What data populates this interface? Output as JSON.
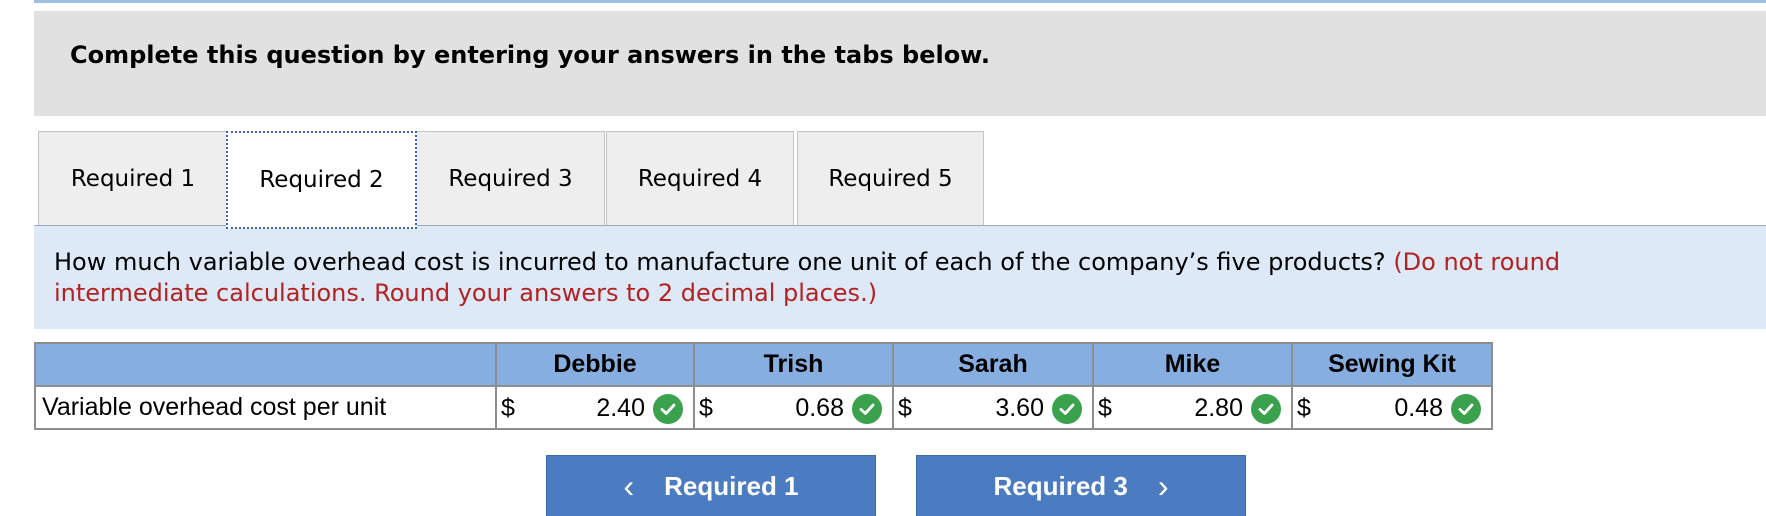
{
  "header": {
    "instruction": "Complete this question by entering your answers in the tabs below."
  },
  "tabs": [
    {
      "label": "Required 1",
      "active": false
    },
    {
      "label": "Required 2",
      "active": true
    },
    {
      "label": "Required 3",
      "active": false
    },
    {
      "label": "Required 4",
      "active": false
    },
    {
      "label": "Required 5",
      "active": false
    }
  ],
  "question": {
    "text": "How much variable overhead cost is incurred to manufacture one unit of each of the company’s five products?",
    "instruction": "(Do not round intermediate calculations. Round your answers to 2 decimal places.)"
  },
  "table": {
    "columns": [
      "Debbie",
      "Trish",
      "Sarah",
      "Mike",
      "Sewing Kit"
    ],
    "row_label": "Variable overhead cost per unit",
    "currency_symbol": "$",
    "values": [
      "2.40",
      "0.68",
      "3.60",
      "2.80",
      "0.48"
    ],
    "status": [
      "correct",
      "correct",
      "correct",
      "correct",
      "correct"
    ]
  },
  "nav": {
    "prev_label": "Required 1",
    "next_label": "Required 3"
  },
  "colors": {
    "header_bg": "#e1e1e1",
    "question_bg": "#dde9f6",
    "instruction_text": "#b22222",
    "table_header_bg": "#87aee0",
    "check_green": "#3aa24c",
    "nav_button_bg": "#4b7bc0"
  }
}
